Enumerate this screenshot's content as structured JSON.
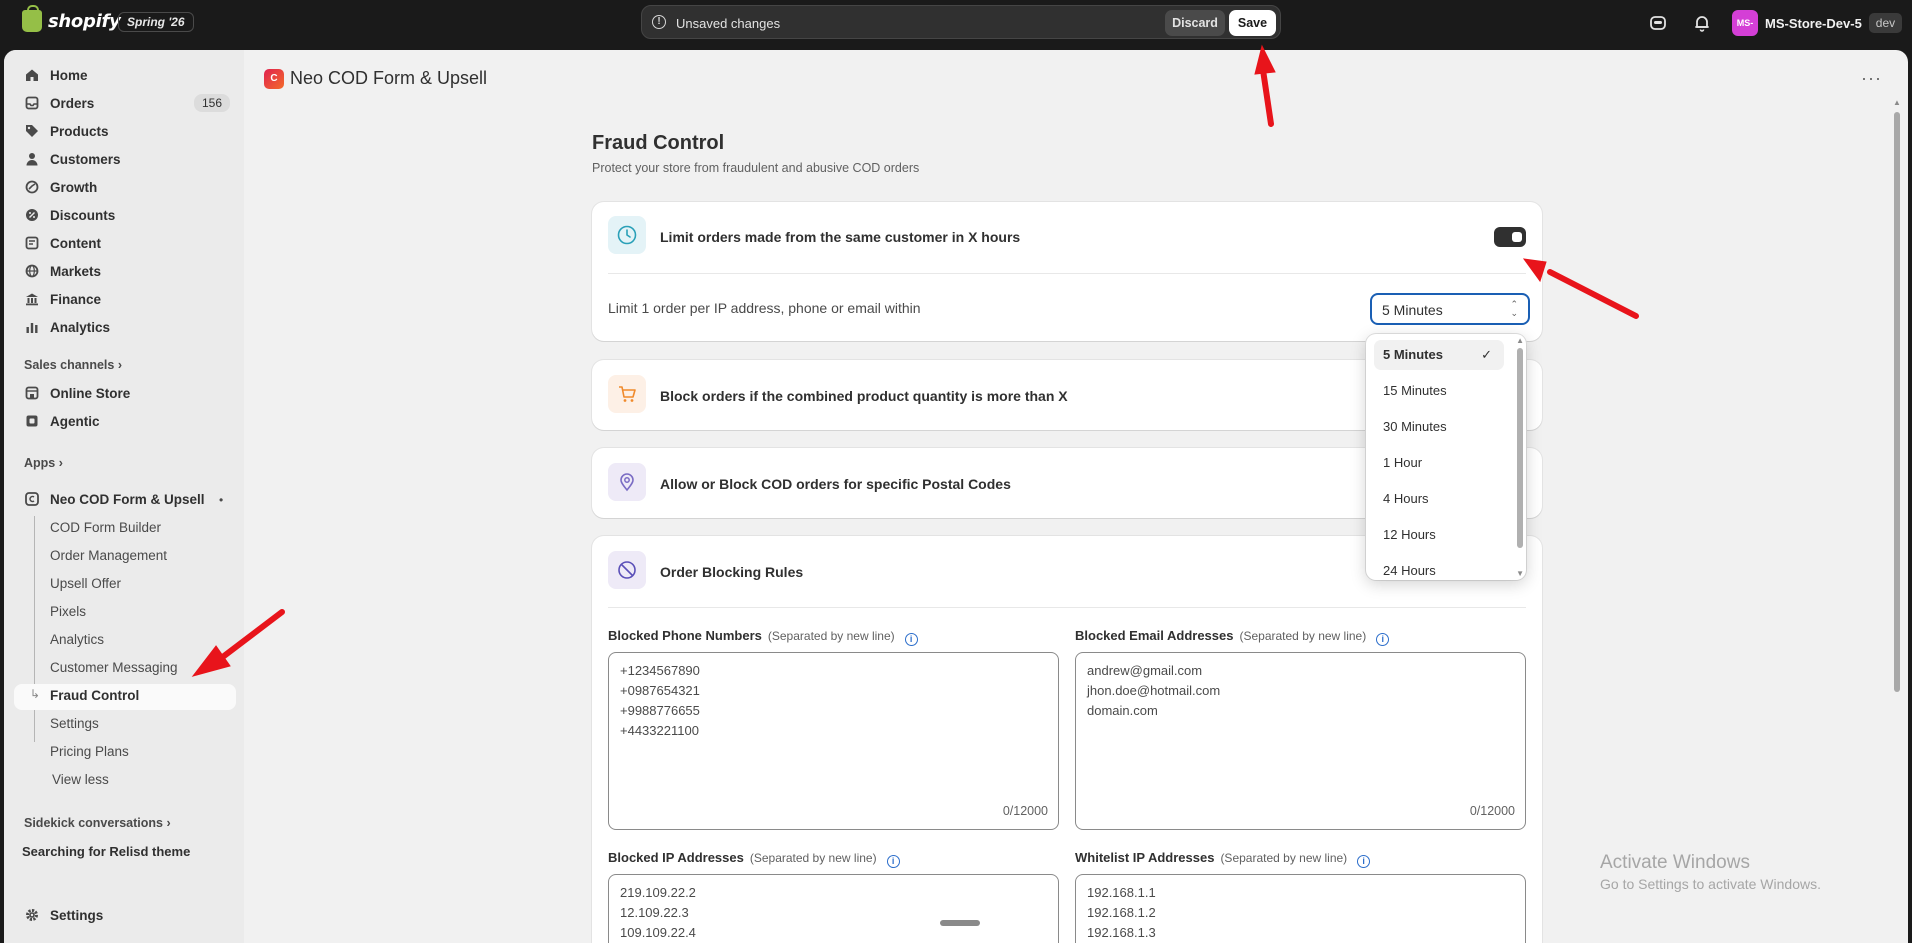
{
  "topbar": {
    "logo_text": "shopify",
    "edition": "Spring '26",
    "unsaved_text": "Unsaved changes",
    "discard_label": "Discard",
    "save_label": "Save",
    "store_avatar": "MS-",
    "store_name": "MS-Store-Dev-5",
    "store_badge": "dev"
  },
  "sidebar": {
    "items": [
      {
        "label": "Home",
        "icon": "home-icon"
      },
      {
        "label": "Orders",
        "icon": "orders-icon",
        "count": "156"
      },
      {
        "label": "Products",
        "icon": "tag-icon"
      },
      {
        "label": "Customers",
        "icon": "person-icon"
      },
      {
        "label": "Growth",
        "icon": "growth-icon"
      },
      {
        "label": "Discounts",
        "icon": "discount-icon"
      },
      {
        "label": "Content",
        "icon": "content-icon"
      },
      {
        "label": "Markets",
        "icon": "globe-icon"
      },
      {
        "label": "Finance",
        "icon": "bank-icon"
      },
      {
        "label": "Analytics",
        "icon": "chart-icon"
      }
    ],
    "sales_channels_label": "Sales channels",
    "channels": [
      {
        "label": "Online Store",
        "icon": "store-icon"
      },
      {
        "label": "Agentic",
        "icon": "agentic-icon"
      }
    ],
    "apps_label": "Apps",
    "app_name": "Neo COD Form & Upsell",
    "app_subitems": [
      "COD Form Builder",
      "Order Management",
      "Upsell Offer",
      "Pixels",
      "Analytics",
      "Customer Messaging",
      "Fraud Control",
      "Settings",
      "Pricing Plans",
      "View less"
    ],
    "sidekick_label": "Sidekick conversations",
    "sidekick_item": "Searching for Relisd theme",
    "settings_label": "Settings"
  },
  "main": {
    "app_title": "Neo COD Form & Upsell",
    "app_icon_text": "C",
    "page_title": "Fraud Control",
    "page_subtitle": "Protect your store from fraudulent and abusive COD orders",
    "limit_card": {
      "title": "Limit orders made from the same customer in X hours",
      "row_text": "Limit 1 order per IP address, phone or email within",
      "select_value": "5 Minutes",
      "toggle_on": true
    },
    "block_qty_title": "Block orders if the combined product quantity is more than X",
    "postal_title": "Allow or Block COD orders for specific Postal Codes",
    "rules_card": {
      "title": "Order Blocking Rules",
      "hint": "(Separated by new line)",
      "phones_label": "Blocked Phone Numbers",
      "phones": [
        "+1234567890",
        "+0987654321",
        "+9988776655",
        "+4433221100"
      ],
      "phones_counter": "0/12000",
      "emails_label": "Blocked Email Addresses",
      "emails": [
        "andrew@gmail.com",
        "jhon.doe@hotmail.com",
        "domain.com"
      ],
      "emails_counter": "0/12000",
      "ips_label": "Blocked IP Addresses",
      "ips": [
        "219.109.22.2",
        "12.109.22.3",
        "109.109.22.4"
      ],
      "whitelist_label": "Whitelist IP Addresses",
      "whitelist": [
        "192.168.1.1",
        "192.168.1.2",
        "192.168.1.3"
      ]
    },
    "dropdown_options": [
      "5 Minutes",
      "15 Minutes",
      "30 Minutes",
      "1 Hour",
      "4 Hours",
      "12 Hours",
      "24 Hours"
    ],
    "dropdown_selected": "5 Minutes"
  },
  "watermark": {
    "line1": "Activate Windows",
    "line2": "Go to Settings to activate Windows."
  },
  "colors": {
    "accent": "#1a5fb4",
    "annotation_arrow": "#e8141b",
    "store_avatar": "#d43fd6"
  }
}
